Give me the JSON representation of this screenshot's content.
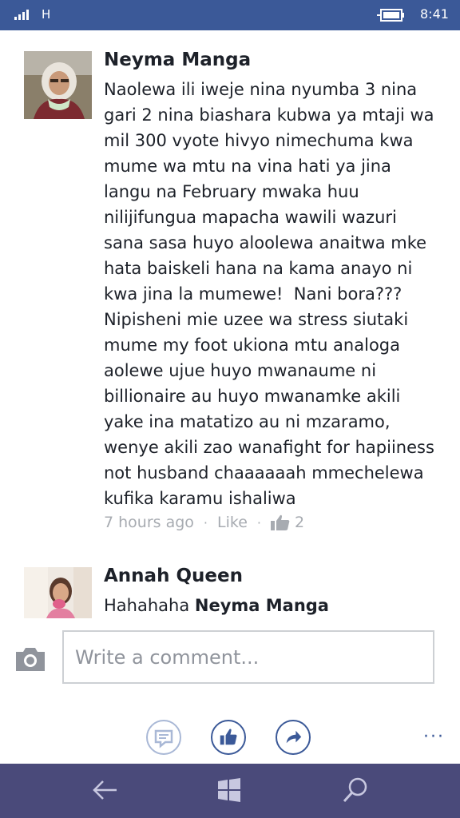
{
  "status_bar": {
    "network": "H",
    "time": "8:41"
  },
  "comments": [
    {
      "author": "Neyma Manga",
      "lines": [
        "Naolewa ili iweje nina nyumba 3 nina",
        "gari 2 nina biashara kubwa ya mtaji wa",
        "mil 300 vyote hivyo nimechuma kwa",
        "mume wa mtu na vina hati ya jina",
        "langu na February mwaka huu",
        "nilijifungua mapacha wawili wazuri",
        "sana sasa huyo aloolewa anaitwa mke",
        "hata baiskeli hana na kama anayo ni",
        "kwa jina la mumewe!  Nani bora???",
        "Nipisheni mie uzee wa stress siutaki",
        "mume my foot ukiona mtu analoga",
        "aolewe ujue huyo mwanaume ni",
        "billionaire au huyo mwanamke akili",
        "yake ina matatizo au ni mzaramo,",
        "wenye akili zao wanafight for hapiiness",
        "not husband chaaaaaah mmechelewa",
        "kufika karamu ishaliwa"
      ],
      "timestamp": "7 hours ago",
      "like_label": "Like",
      "like_count": "2",
      "separator": "·"
    },
    {
      "author": "Annah Queen",
      "text_prefix": "Hahahaha",
      "mention": "Neyma Manga"
    }
  ],
  "composer": {
    "placeholder": "Write a comment..."
  },
  "actions": [
    "reply-bubble-icon",
    "thumbs-up-icon",
    "share-arrow-icon"
  ],
  "more_label": "···",
  "colors": {
    "brand": "#3b5998",
    "nav_bar": "#4a4a7a",
    "meta_text": "#a7abb1"
  }
}
